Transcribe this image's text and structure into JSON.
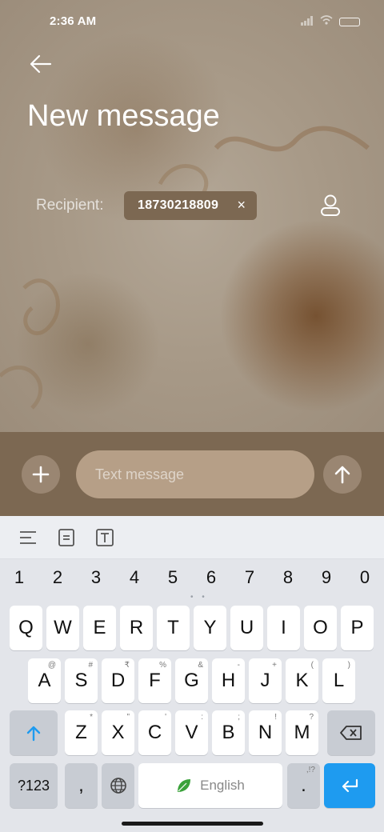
{
  "status_bar": {
    "time": "2:36 AM"
  },
  "header": {
    "title": "New message"
  },
  "recipient": {
    "label": "Recipient:",
    "chip_value": "18730218809",
    "chip_remove": "×"
  },
  "compose": {
    "placeholder": "Text message"
  },
  "keyboard": {
    "numbers": [
      "1",
      "2",
      "3",
      "4",
      "5",
      "6",
      "7",
      "8",
      "9",
      "0"
    ],
    "row1": [
      "Q",
      "W",
      "E",
      "R",
      "T",
      "Y",
      "U",
      "I",
      "O",
      "P"
    ],
    "row2": [
      {
        "k": "A",
        "s": "@"
      },
      {
        "k": "S",
        "s": "#"
      },
      {
        "k": "D",
        "s": "₹"
      },
      {
        "k": "F",
        "s": "%"
      },
      {
        "k": "G",
        "s": "&"
      },
      {
        "k": "H",
        "s": "-"
      },
      {
        "k": "J",
        "s": "+"
      },
      {
        "k": "K",
        "s": "("
      },
      {
        "k": "L",
        "s": ")"
      }
    ],
    "row3": [
      {
        "k": "Z",
        "s": "*"
      },
      {
        "k": "X",
        "s": "\""
      },
      {
        "k": "C",
        "s": "'"
      },
      {
        "k": "V",
        "s": ":"
      },
      {
        "k": "B",
        "s": ";"
      },
      {
        "k": "N",
        "s": "!"
      },
      {
        "k": "M",
        "s": "?"
      }
    ],
    "sym_key": "?123",
    "comma": ",",
    "space_label": "English",
    "period": ".",
    "period_sup": ",!?"
  }
}
